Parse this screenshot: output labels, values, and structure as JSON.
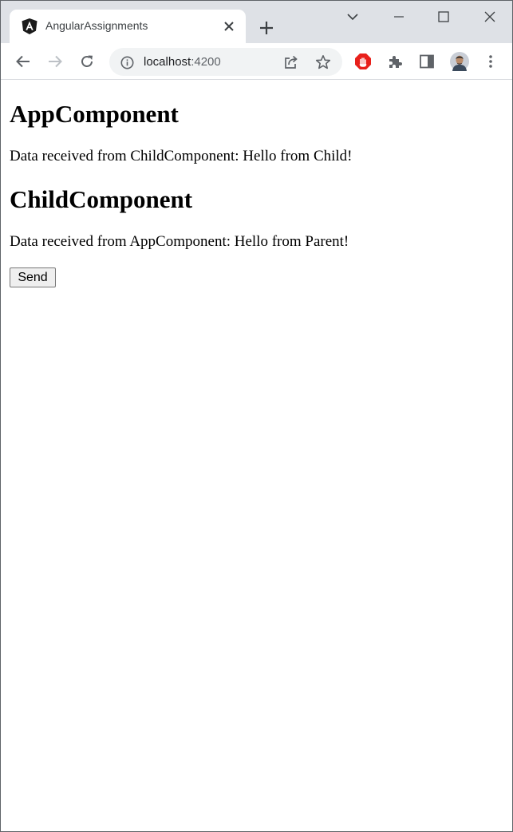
{
  "browser": {
    "tab": {
      "title": "AngularAssignments",
      "favicon": "angular-icon"
    },
    "address": {
      "host": "localhost",
      "port": ":4200"
    },
    "colors": {
      "tabstrip": "#dee1e6",
      "omnibox": "#f1f3f4",
      "adblock": "#e8201b"
    }
  },
  "page": {
    "app_heading": "AppComponent",
    "app_text": "Data received from ChildComponent: Hello from Child!",
    "child_heading": "ChildComponent",
    "child_text": "Data received from AppComponent: Hello from Parent!",
    "send_label": "Send"
  }
}
